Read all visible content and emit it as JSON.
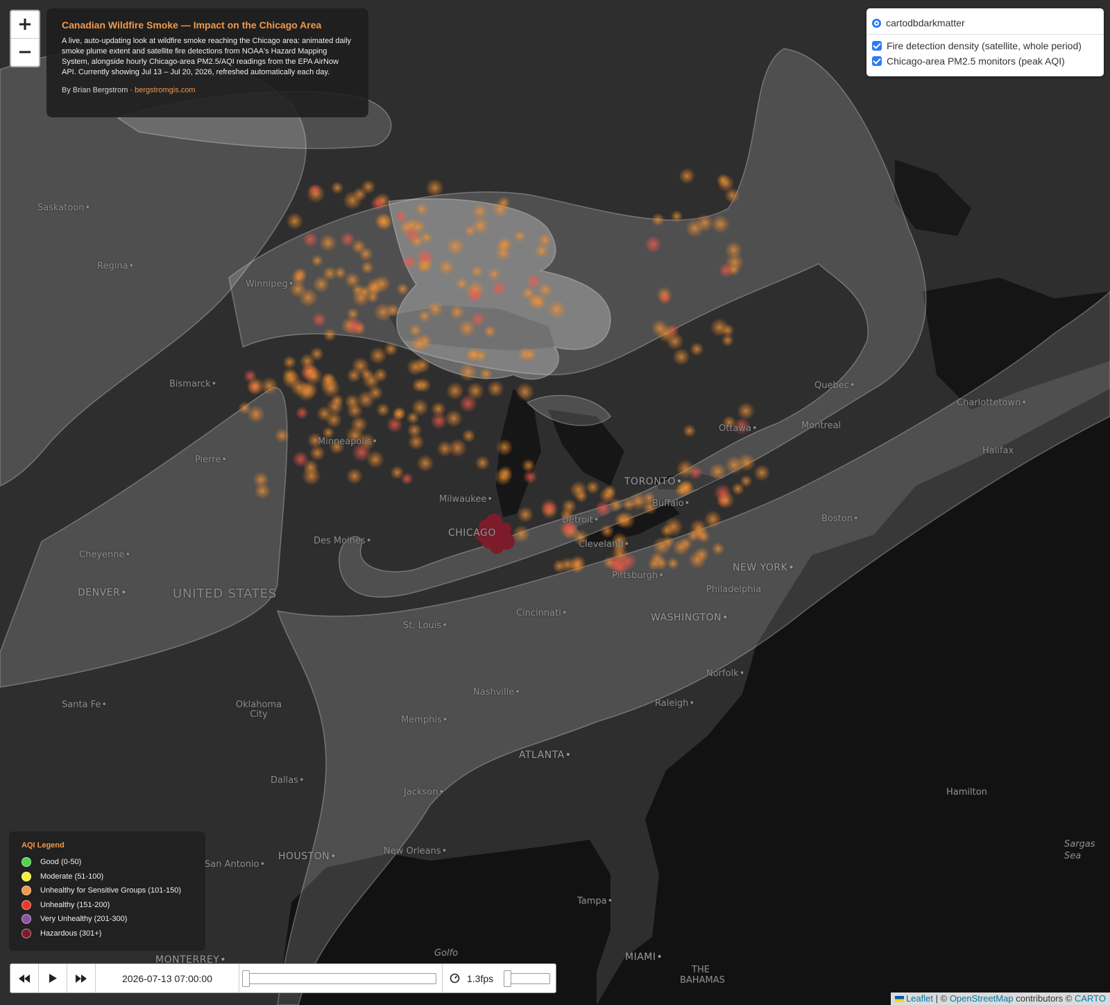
{
  "title_panel": {
    "title": "Canadian Wildfire Smoke — Impact on the Chicago Area",
    "description": "A live, auto-updating look at wildfire smoke reaching the Chicago area: animated daily smoke plume extent and satellite fire detections from NOAA's Hazard Mapping System, alongside hourly Chicago-area PM2.5/AQI readings from the EPA AirNow API. Currently showing Jul 13 – Jul 20, 2026, refreshed automatically each day.",
    "byline_prefix": "By Brian Bergstrom ·",
    "byline_link": "bergstromgis.com"
  },
  "zoom": {
    "in_label": "+",
    "out_label": "−"
  },
  "layers": {
    "basemap": "cartodbdarkmatter",
    "overlays": [
      "Fire detection density (satellite, whole period)",
      "Chicago-area PM2.5 monitors (peak AQI)"
    ]
  },
  "legend": {
    "title": "AQI Legend",
    "items": [
      {
        "label": "Good (0-50)",
        "color": "#4cd44c"
      },
      {
        "label": "Moderate (51-100)",
        "color": "#f2f23a"
      },
      {
        "label": "Unhealthy for Sensitive Groups (101-150)",
        "color": "#f2994a"
      },
      {
        "label": "Unhealthy (151-200)",
        "color": "#e8392a"
      },
      {
        "label": "Very Unhealthy (201-300)",
        "color": "#8e4fa6"
      },
      {
        "label": "Hazardous (301+)",
        "color": "#7e1b2a"
      }
    ]
  },
  "timeline": {
    "backward_icon": "rewind-icon",
    "play_icon": "play-icon",
    "forward_icon": "fast-forward-icon",
    "current_time": "2026-07-13 07:00:00",
    "speed_icon": "speedometer-icon",
    "speed": "1.3fps"
  },
  "attribution": {
    "leaflet": "Leaflet",
    "sep": "| ©",
    "osm": "OpenStreetMap",
    "contributors": "contributors ©",
    "carto": "CARTO"
  },
  "cities": [
    "Saskatoon",
    "Regina",
    "Winnipeg",
    "Bismarck",
    "Pierre",
    "Minneapolis",
    "Cheyenne",
    "DENVER",
    "UNITED STATES",
    "Des Moines",
    "Milwaukee",
    "CHICAGO",
    "Detroit",
    "Cleveland",
    "Pittsburgh",
    "TORONTO",
    "Buffalo",
    "Ottawa",
    "Montreal",
    "Quebec",
    "Charlottetown",
    "Halifax",
    "Boston",
    "NEW YORK",
    "Philadelphia",
    "WASHINGTON",
    "Cincinnati",
    "St. Louis",
    "Nashville",
    "Norfolk",
    "Raleigh",
    "Santa Fe",
    "Oklahoma City",
    "Memphis",
    "ATLANTA",
    "Dallas",
    "Jackson",
    "Hamilton",
    "New Orleans",
    "HOUSTON",
    "San Antonio",
    "Tampa",
    "MIAMI",
    "MONTERREY",
    "THE BAHAMAS",
    "Golfo",
    "Sargas Sea"
  ],
  "colors": {
    "smoke": "#ffffff",
    "fire": "#f2994a",
    "hazard": "#7e1b2a",
    "land": "#2c2c2c",
    "water": "#0f0f0f"
  }
}
